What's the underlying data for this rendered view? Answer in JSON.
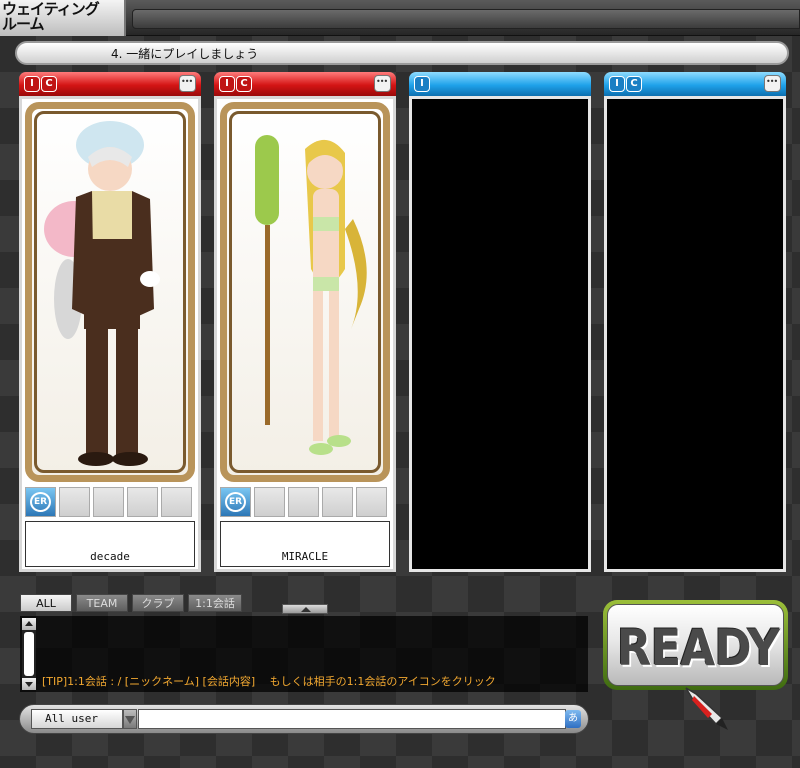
{
  "window": {
    "title_line1": "ウェイティング",
    "title_line2": "ルーム"
  },
  "room": {
    "name": "4. 一緒にプレイしましょう"
  },
  "slots": [
    {
      "header_color": "#d41414",
      "icons": [
        "I",
        "C"
      ],
      "player_name": "decade",
      "emblem": "ER",
      "empty": false
    },
    {
      "header_color": "#d41414",
      "icons": [
        "I",
        "C"
      ],
      "player_name": "MIRACLE",
      "emblem": "ER",
      "empty": false
    },
    {
      "header_color": "#1fa2ea",
      "icons": [
        "I"
      ],
      "player_name": "",
      "emblem": "",
      "empty": true
    },
    {
      "header_color": "#1fa2ea",
      "icons": [
        "I",
        "C"
      ],
      "player_name": "",
      "emblem": "",
      "empty": true
    }
  ],
  "chat": {
    "tabs": [
      "ALL",
      "TEAM",
      "クラブ",
      "1:1会話"
    ],
    "active_tab": "ALL",
    "tip": "[TIP]1:1会話 : / [ニックネーム] [会話内容]　 もしくは相手の1:1会話のアイコンをクリック",
    "recipient": "All user",
    "input_value": "",
    "ime_label": "あ"
  },
  "ready": {
    "label": "READY"
  },
  "icons": {
    "chat_bubble": "speech-bubble-icon",
    "emblem": "er-emblem-icon",
    "cursor": "crayon-cursor-icon"
  },
  "colors": {
    "team_red": "#d41414",
    "team_blue": "#1fa2ea",
    "ready_border": "#9cbf3a",
    "tip_text": "#f2a830"
  }
}
